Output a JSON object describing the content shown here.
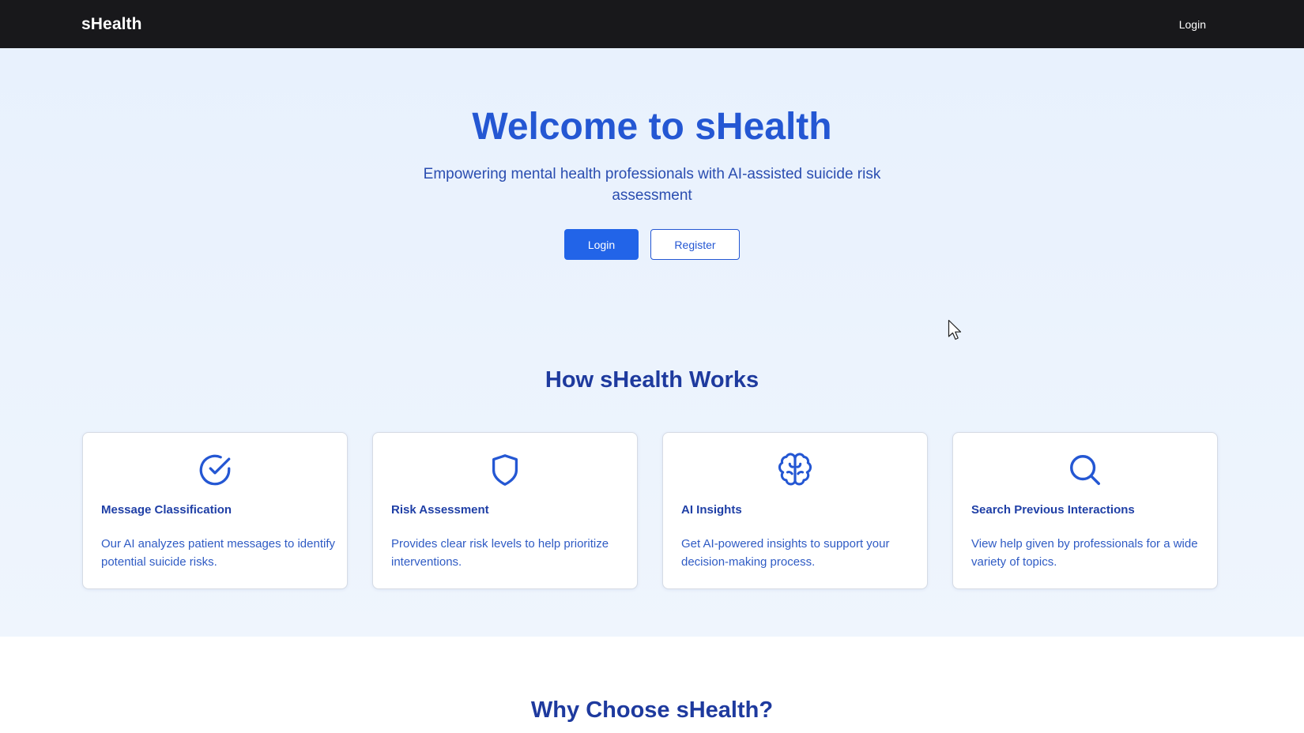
{
  "navbar": {
    "brand": "sHealth",
    "login_label": "Login"
  },
  "hero": {
    "title": "Welcome to sHealth",
    "subtitle": "Empowering mental health professionals with AI-assisted suicide risk assessment",
    "login_label": "Login",
    "register_label": "Register"
  },
  "how": {
    "title": "How sHealth Works",
    "cards": [
      {
        "icon": "check-circle-icon",
        "title": "Message Classification",
        "description": "Our AI analyzes patient messages to identify potential suicide risks."
      },
      {
        "icon": "shield-icon",
        "title": "Risk Assessment",
        "description": "Provides clear risk levels to help prioritize interventions."
      },
      {
        "icon": "brain-icon",
        "title": "AI Insights",
        "description": "Get AI-powered insights to support your decision-making process."
      },
      {
        "icon": "search-icon",
        "title": "Search Previous Interactions",
        "description": "View help given by professionals for a wide variety of topics."
      }
    ]
  },
  "why": {
    "title": "Why Choose sHealth?"
  },
  "colors": {
    "navbar_bg": "#18181b",
    "primary": "#2264e8",
    "heading": "#2457d3",
    "section_heading": "#1e3a9e",
    "hero_bg": "#eaf2fd"
  }
}
